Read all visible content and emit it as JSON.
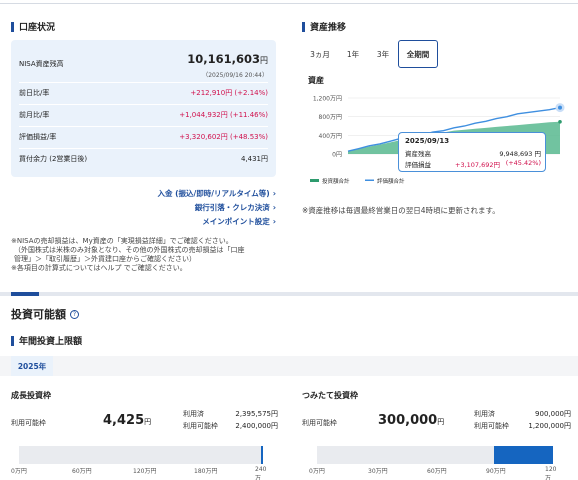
{
  "account": {
    "title": "口座状況",
    "balance_label": "NISA資産残高",
    "balance_value": "10,161,603",
    "balance_unit": "円",
    "balance_timestamp": "（2025/09/16 20:44）",
    "rows": [
      {
        "label": "前日比/率",
        "value": "+212,910円 (+2.14%)",
        "color": "red"
      },
      {
        "label": "前月比/率",
        "value": "+1,044,932円 (+11.46%)",
        "color": "red"
      },
      {
        "label": "評価損益/率",
        "value": "+3,320,602円 (+48.53%)",
        "color": "red"
      },
      {
        "label": "買付余力 (2営業日後)",
        "value": "4,431円",
        "color": "black"
      }
    ],
    "links": [
      "入金 (振込/即時/リアルタイム等)",
      "銀行引落・クレカ決済",
      "メインポイント設定"
    ],
    "notes": [
      "※NISAの売却損益は、My資産の「実現損益詳細」でご確認ください。",
      "（外国株式は米株のみ対象となり、その他の外国株式の売却損益は「口座",
      "管理」＞「取引履歴」＞外貨建口座からご確認ください）",
      "※各項目の計算式についてはヘルプ でご確認ください。"
    ]
  },
  "trend": {
    "title": "資産推移",
    "tabs": [
      "3ヵ月",
      "1年",
      "3年",
      "全期間"
    ],
    "active_tab": "全期間",
    "footnote": "※資産推移は毎週最終営業日の翌日4時頃に更新されます。"
  },
  "chart_data": {
    "type": "area",
    "ylabel": "資産",
    "ylim": [
      0,
      1200
    ],
    "yticks": [
      "1,200万円",
      "800万円",
      "400万円",
      "0円"
    ],
    "ytick_values": [
      1200,
      800,
      400,
      0
    ],
    "x": [
      0,
      1,
      2,
      3,
      4,
      5,
      6,
      7,
      8,
      9,
      10,
      11,
      12,
      13,
      14,
      15,
      16,
      17,
      18,
      19,
      20
    ],
    "series": [
      {
        "name": "投資額合計",
        "color": "#2e9b6e",
        "values": [
          60,
          110,
          160,
          200,
          250,
          300,
          340,
          380,
          420,
          460,
          500,
          520,
          540,
          560,
          580,
          600,
          620,
          640,
          660,
          680,
          690
        ]
      },
      {
        "name": "評価額合計",
        "color": "#3f8fe0",
        "values": [
          60,
          115,
          175,
          215,
          275,
          335,
          375,
          410,
          470,
          500,
          560,
          600,
          660,
          700,
          760,
          800,
          860,
          890,
          920,
          950,
          995
        ]
      }
    ],
    "tooltip": {
      "date": "2025/09/13",
      "rows": [
        {
          "label": "資産残高",
          "value": "9,948,693 円",
          "color": "black"
        },
        {
          "label": "評価損益",
          "value": "+3,107,692円",
          "extra": "(+45.42%)",
          "color": "red"
        }
      ]
    }
  },
  "investment": {
    "title": "投資可能額",
    "annual_title": "年間投資上限額",
    "year": "2025年",
    "growth": {
      "title": "成長投資枠",
      "available_label": "利用可能枠",
      "available_value": "4,425",
      "unit": "円",
      "used_label": "利用済",
      "used_value": "2,395,575円",
      "limit_label": "利用可能枠",
      "limit_value": "2,400,000円",
      "used_fraction": 0.998,
      "ticks": [
        "0万円",
        "60万円",
        "120万円",
        "180万円",
        "240万円"
      ]
    },
    "tsumitate": {
      "title": "つみたて投資枠",
      "available_label": "利用可能枠",
      "available_value": "300,000",
      "unit": "円",
      "used_label": "利用済",
      "used_value": "900,000円",
      "limit_label": "利用可能枠",
      "limit_value": "1,200,000円",
      "used_fraction": 0.75,
      "ticks": [
        "0万円",
        "30万円",
        "60万円",
        "90万円",
        "120万円"
      ]
    }
  },
  "colors": {
    "accent": "#1f4e9c",
    "red": "#d0104c",
    "panel": "#eaf2fb",
    "bar_used": "#1565c0",
    "bar_bg": "#e9ebef"
  }
}
